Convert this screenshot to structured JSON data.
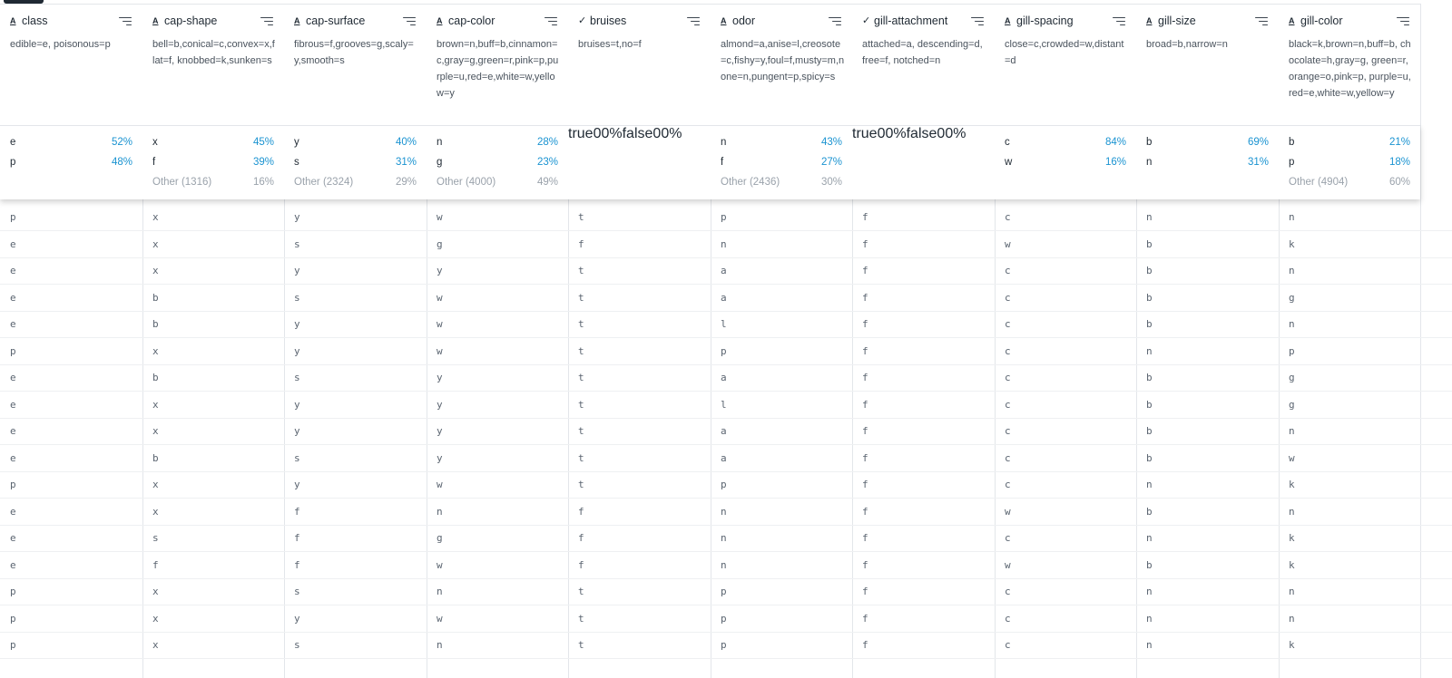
{
  "columns": [
    {
      "name": "class",
      "type": "string",
      "description": "edible=e, poisonous=p",
      "top": [
        [
          "e",
          "52%"
        ],
        [
          "p",
          "48%"
        ]
      ],
      "other": null
    },
    {
      "name": "cap-shape",
      "type": "string",
      "description": "bell=b,conical=c,convex=x,flat=f, knobbed=k,sunken=s",
      "top": [
        [
          "x",
          "45%"
        ],
        [
          "f",
          "39%"
        ]
      ],
      "other": [
        "Other (1316)",
        "16%"
      ]
    },
    {
      "name": "cap-surface",
      "type": "string",
      "description": "fibrous=f,grooves=g,scaly=y,smooth=s",
      "top": [
        [
          "y",
          "40%"
        ],
        [
          "s",
          "31%"
        ]
      ],
      "other": [
        "Other (2324)",
        "29%"
      ]
    },
    {
      "name": "cap-color",
      "type": "string",
      "description": "brown=n,buff=b,cinnamon=c,gray=g,green=r,pink=p,purple=u,red=e,white=w,yellow=y",
      "top": [
        [
          "n",
          "28%"
        ],
        [
          "g",
          "23%"
        ]
      ],
      "other": [
        "Other (4000)",
        "49%"
      ]
    },
    {
      "name": "bruises",
      "type": "bool",
      "description": "bruises=t,no=f",
      "bool": [
        [
          "true",
          "0",
          "0%"
        ],
        [
          "false",
          "0",
          "0%"
        ]
      ]
    },
    {
      "name": "odor",
      "type": "string",
      "description": "almond=a,anise=l,creosote=c,fishy=y,foul=f,musty=m,none=n,pungent=p,spicy=s",
      "top": [
        [
          "n",
          "43%"
        ],
        [
          "f",
          "27%"
        ]
      ],
      "other": [
        "Other (2436)",
        "30%"
      ]
    },
    {
      "name": "gill-attachment",
      "type": "bool",
      "description": "attached=a, descending=d, free=f, notched=n",
      "bool": [
        [
          "true",
          "0",
          "0%"
        ],
        [
          "false",
          "0",
          "0%"
        ]
      ]
    },
    {
      "name": "gill-spacing",
      "type": "string",
      "description": "close=c,crowded=w,distant=d",
      "top": [
        [
          "c",
          "84%"
        ],
        [
          "w",
          "16%"
        ]
      ],
      "other": null
    },
    {
      "name": "gill-size",
      "type": "string",
      "description": "broad=b,narrow=n",
      "top": [
        [
          "b",
          "69%"
        ],
        [
          "n",
          "31%"
        ]
      ],
      "other": null
    },
    {
      "name": "gill-color",
      "type": "string",
      "description": "black=k,brown=n,buff=b, chocolate=h,gray=g, green=r,orange=o,pink=p, purple=u,red=e,white=w,yellow=y",
      "top": [
        [
          "b",
          "21%"
        ],
        [
          "p",
          "18%"
        ]
      ],
      "other": [
        "Other (4904)",
        "60%"
      ]
    }
  ],
  "rows": [
    [
      "p",
      "x",
      "y",
      "w",
      "t",
      "p",
      "f",
      "c",
      "n",
      "n"
    ],
    [
      "e",
      "x",
      "s",
      "g",
      "f",
      "n",
      "f",
      "w",
      "b",
      "k"
    ],
    [
      "e",
      "x",
      "y",
      "y",
      "t",
      "a",
      "f",
      "c",
      "b",
      "n"
    ],
    [
      "e",
      "b",
      "s",
      "w",
      "t",
      "a",
      "f",
      "c",
      "b",
      "g"
    ],
    [
      "e",
      "b",
      "y",
      "w",
      "t",
      "l",
      "f",
      "c",
      "b",
      "n"
    ],
    [
      "p",
      "x",
      "y",
      "w",
      "t",
      "p",
      "f",
      "c",
      "n",
      "p"
    ],
    [
      "e",
      "b",
      "s",
      "y",
      "t",
      "a",
      "f",
      "c",
      "b",
      "g"
    ],
    [
      "e",
      "x",
      "y",
      "y",
      "t",
      "l",
      "f",
      "c",
      "b",
      "g"
    ],
    [
      "e",
      "x",
      "y",
      "y",
      "t",
      "a",
      "f",
      "c",
      "b",
      "n"
    ],
    [
      "e",
      "b",
      "s",
      "y",
      "t",
      "a",
      "f",
      "c",
      "b",
      "w"
    ],
    [
      "p",
      "x",
      "y",
      "w",
      "t",
      "p",
      "f",
      "c",
      "n",
      "k"
    ],
    [
      "e",
      "x",
      "f",
      "n",
      "f",
      "n",
      "f",
      "w",
      "b",
      "n"
    ],
    [
      "e",
      "s",
      "f",
      "g",
      "f",
      "n",
      "f",
      "c",
      "n",
      "k"
    ],
    [
      "e",
      "f",
      "f",
      "w",
      "f",
      "n",
      "f",
      "w",
      "b",
      "k"
    ],
    [
      "p",
      "x",
      "s",
      "n",
      "t",
      "p",
      "f",
      "c",
      "n",
      "n"
    ],
    [
      "p",
      "x",
      "y",
      "w",
      "t",
      "p",
      "f",
      "c",
      "n",
      "n"
    ],
    [
      "p",
      "x",
      "s",
      "n",
      "t",
      "p",
      "f",
      "c",
      "n",
      "k"
    ]
  ],
  "icons": {
    "string": "text-type-icon",
    "bool": "check-type-icon",
    "sort": "sort-icon"
  },
  "colors": {
    "accent": "#1a93d1",
    "border": "#e3e6ea",
    "muted": "#9aa2ab"
  }
}
